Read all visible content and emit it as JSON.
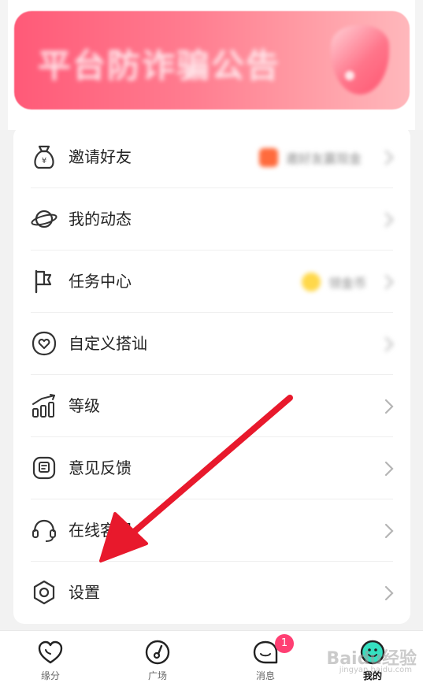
{
  "banner": {
    "text": "平台防诈骗公告"
  },
  "menu": [
    {
      "label": "邀请好友",
      "icon": "money-bag-icon",
      "extra": "邀好友赢现金",
      "extra_color": "#ff6b3d"
    },
    {
      "label": "我的动态",
      "icon": "planet-icon"
    },
    {
      "label": "任务中心",
      "icon": "flag-icon",
      "extra": "领金币",
      "extra_color": "#ffd84a"
    },
    {
      "label": "自定义搭讪",
      "icon": "heart-bubble-icon"
    },
    {
      "label": "等级",
      "icon": "level-bars-icon"
    },
    {
      "label": "意见反馈",
      "icon": "feedback-icon"
    },
    {
      "label": "在线客服",
      "icon": "headset-icon"
    },
    {
      "label": "设置",
      "icon": "settings-hex-icon"
    }
  ],
  "tabs": [
    {
      "label": "缘分",
      "icon": "heart-tab-icon"
    },
    {
      "label": "广场",
      "icon": "compass-tab-icon"
    },
    {
      "label": "消息",
      "icon": "message-tab-icon",
      "badge": "1"
    },
    {
      "label": "我的",
      "icon": "profile-tab-icon",
      "active": true
    }
  ],
  "watermark": {
    "text": "Baidu经验",
    "sub": "jingyan.baidu.com"
  },
  "colors": {
    "accent": "#ff3f73",
    "arrow": "#e8192c"
  }
}
